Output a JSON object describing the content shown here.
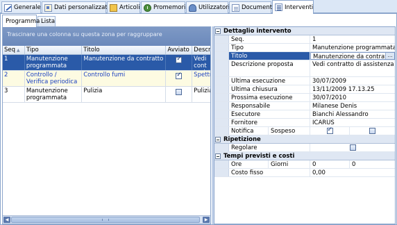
{
  "tabs": [
    {
      "label": "Generale",
      "icon": "pencil-icon"
    },
    {
      "label": "Dati personalizzati",
      "icon": "card-icon"
    },
    {
      "label": "Articoli",
      "icon": "box-icon"
    },
    {
      "label": "Promemoria",
      "icon": "clock-icon"
    },
    {
      "label": "Utilizzatori",
      "icon": "users-icon"
    },
    {
      "label": "Documenti",
      "icon": "document-icon"
    },
    {
      "label": "Interventi",
      "icon": "list-icon"
    }
  ],
  "subtabs": [
    "Programma",
    "Lista"
  ],
  "grid": {
    "group_hint": "Trascinare una colonna su questa zona per raggruppare",
    "columns": [
      "Seq",
      "Tipo",
      "Titolo",
      "Avviato",
      "Descri"
    ],
    "rows": [
      {
        "seq": "1",
        "tipo": "Manutenzione programmata",
        "titolo": "Manutenzione da contratto",
        "avviato": true,
        "descr": "Vedi cont assiste"
      },
      {
        "seq": "2",
        "tipo": "Controllo / Verifica periodica",
        "titolo": "Controllo fumi",
        "avviato": true,
        "descr": "Spettro"
      },
      {
        "seq": "3",
        "tipo": "Manutenzione programmata",
        "titolo": "Pulizia",
        "avviato": false,
        "descr": "Pulizia"
      }
    ]
  },
  "detail": {
    "section_title": "Dettaglio intervento",
    "seq": {
      "label": "Seq.",
      "value": "1"
    },
    "tipo": {
      "label": "Tipo",
      "value": "Manutenzione programmata"
    },
    "titolo": {
      "label": "Titolo",
      "value": "Manutenzione da contratto"
    },
    "descrizione": {
      "label": "Descrizione proposta",
      "value": "Vedi contratto di assistenza"
    },
    "ultima_esecuzione": {
      "label": "Ultima esecuzione",
      "value": "30/07/2009"
    },
    "ultima_chiusura": {
      "label": "Ultima chiusura",
      "value": "13/11/2009 17.13.25"
    },
    "prossima_esecuzione": {
      "label": "Prossima esecuzione",
      "value": "30/07/2010"
    },
    "responsabile": {
      "label": "Responsabile",
      "value": "Milanese Denis"
    },
    "esecutore": {
      "label": "Esecutore",
      "value": "Bianchi Alessandro"
    },
    "fornitore": {
      "label": "Fornitore",
      "value": "ICARUS"
    },
    "notifica_label": "Notifica",
    "sospeso_label": "Sospeso",
    "notifica_checked": true,
    "sospeso_checked": false
  },
  "ripetizione": {
    "section_title": "Ripetizione",
    "regolare_label": "Regolare",
    "regolare_checked": false
  },
  "tempi": {
    "section_title": "Tempi previsti e costi",
    "ore_label": "Ore",
    "ore_value": "0",
    "giorni_label": "Giorni",
    "giorni_value": "0",
    "costo_label": "Costo fisso",
    "costo_value": "0,00"
  }
}
